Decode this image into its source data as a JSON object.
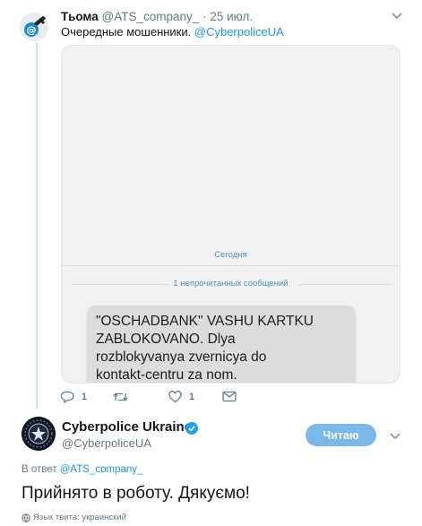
{
  "tweet1": {
    "author_name": "Тьома",
    "author_handle": "@ATS_company_",
    "separator": "·",
    "date": "25 июл.",
    "text": "Очередные мошенники.",
    "mention": "@CyberpoliceUA",
    "media": {
      "date_label": "Сегодня",
      "unread_label": "1 непрочитанных сообщений",
      "sms_text": "\"OSCHADBANK\"  VASHU KARTKU\nZABLOKOVANO. Dlya\nrozblokyvanya zvernicya do\nkontakt-centru za nom."
    },
    "actions": {
      "reply_count": "1",
      "retweet_count": "",
      "like_count": "1"
    }
  },
  "tweet2": {
    "author_name": "Cyberpolice Ukraine",
    "author_handle": "@CyberpoliceUA",
    "follow_label": "Читаю",
    "reply_to_prefix": "В ответ",
    "reply_to_handle": "@ATS_company_",
    "text": "Прийнято в роботу. Дякуємо!",
    "language_label": "Язык твита: украинский"
  },
  "colors": {
    "accent": "#1b95e0",
    "follow_button": "#7ab8ea",
    "thread_line": "#c4e4f5",
    "muted": "#657786"
  }
}
